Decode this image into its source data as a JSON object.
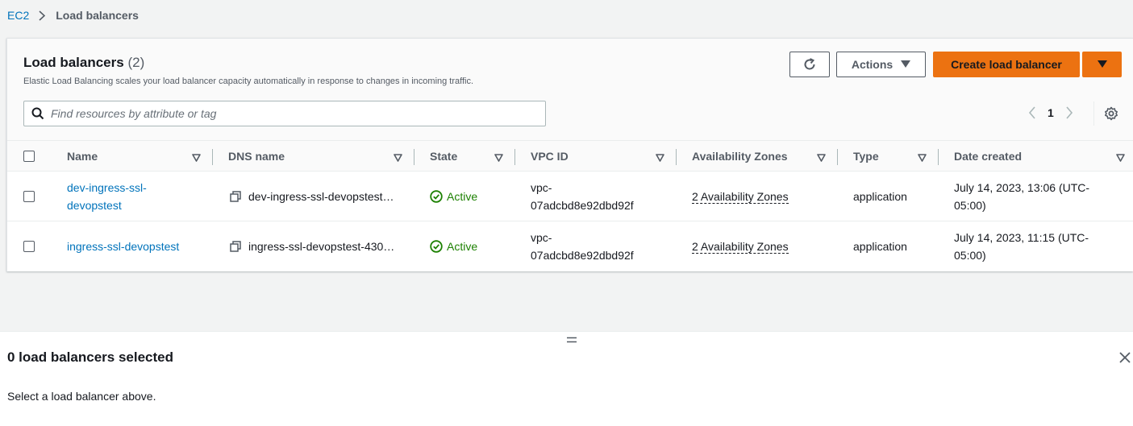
{
  "breadcrumb": {
    "root": "EC2",
    "current": "Load balancers"
  },
  "panel": {
    "title": "Load balancers",
    "count": "(2)",
    "description": "Elastic Load Balancing scales your load balancer capacity automatically in response to changes in incoming traffic.",
    "actions_label": "Actions",
    "create_label": "Create load balancer",
    "search_placeholder": "Find resources by attribute or tag",
    "page_number": "1"
  },
  "table": {
    "columns": [
      "Name",
      "DNS name",
      "State",
      "VPC ID",
      "Availability Zones",
      "Type",
      "Date created"
    ],
    "rows": [
      {
        "name_line1": "dev-ingress-ssl-",
        "name_line2": "devopstest",
        "dns": "dev-ingress-ssl-devopstest…",
        "state": "Active",
        "vpc_line1": "vpc-",
        "vpc_line2": "07adcbd8e92dbd92f",
        "azs": "2 Availability Zones",
        "type": "application",
        "date_line1": "July 14, 2023, 13:06 (UTC-",
        "date_line2": "05:00)"
      },
      {
        "name_line1": "ingress-ssl-devopstest",
        "name_line2": "",
        "dns": "ingress-ssl-devopstest-430…",
        "state": "Active",
        "vpc_line1": "vpc-",
        "vpc_line2": "07adcbd8e92dbd92f",
        "azs": "2 Availability Zones",
        "type": "application",
        "date_line1": "July 14, 2023, 11:15 (UTC-",
        "date_line2": "05:00)"
      }
    ]
  },
  "split_panel": {
    "title": "0 load balancers selected",
    "text": "Select a load balancer above."
  },
  "colors": {
    "link": "#0073bb",
    "primary": "#ec7211",
    "success": "#1d8102"
  },
  "icons": [
    "chevron-right-icon",
    "refresh-icon",
    "caret-down-icon",
    "search-icon",
    "chevron-left-icon",
    "settings-icon",
    "sort-icon",
    "copy-icon",
    "check-circle-icon",
    "drag-handle-icon",
    "close-icon"
  ]
}
